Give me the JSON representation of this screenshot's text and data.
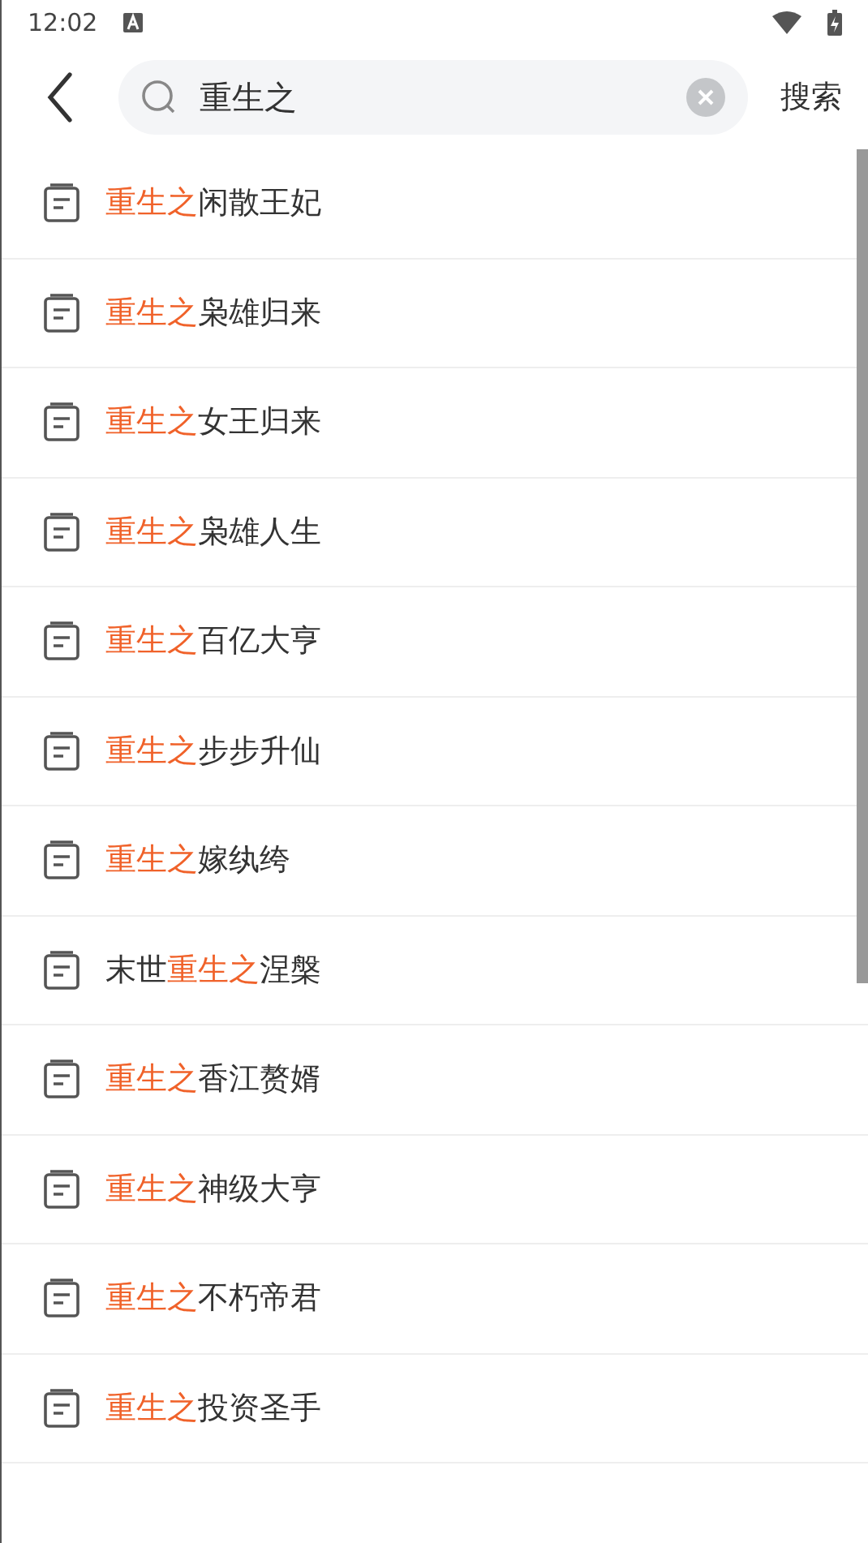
{
  "status_bar": {
    "time": "12:02"
  },
  "search": {
    "value": "重生之",
    "button": "搜索"
  },
  "results": [
    {
      "parts": [
        {
          "text": "重生之",
          "match": true
        },
        {
          "text": "闲散王妃",
          "match": false
        }
      ]
    },
    {
      "parts": [
        {
          "text": "重生之",
          "match": true
        },
        {
          "text": "枭雄归来",
          "match": false
        }
      ]
    },
    {
      "parts": [
        {
          "text": "重生之",
          "match": true
        },
        {
          "text": "女王归来",
          "match": false
        }
      ]
    },
    {
      "parts": [
        {
          "text": "重生之",
          "match": true
        },
        {
          "text": "枭雄人生",
          "match": false
        }
      ]
    },
    {
      "parts": [
        {
          "text": "重生之",
          "match": true
        },
        {
          "text": "百亿大亨",
          "match": false
        }
      ]
    },
    {
      "parts": [
        {
          "text": "重生之",
          "match": true
        },
        {
          "text": "步步升仙",
          "match": false
        }
      ]
    },
    {
      "parts": [
        {
          "text": "重生之",
          "match": true
        },
        {
          "text": "嫁纨绔",
          "match": false
        }
      ]
    },
    {
      "parts": [
        {
          "text": "末世",
          "match": false
        },
        {
          "text": "重生之",
          "match": true
        },
        {
          "text": "涅槃",
          "match": false
        }
      ]
    },
    {
      "parts": [
        {
          "text": "重生之",
          "match": true
        },
        {
          "text": "香江赘婿",
          "match": false
        }
      ]
    },
    {
      "parts": [
        {
          "text": "重生之",
          "match": true
        },
        {
          "text": "神级大亨",
          "match": false
        }
      ]
    },
    {
      "parts": [
        {
          "text": "重生之",
          "match": true
        },
        {
          "text": "不朽帝君",
          "match": false
        }
      ]
    },
    {
      "parts": [
        {
          "text": "重生之",
          "match": true
        },
        {
          "text": "投资圣手",
          "match": false
        }
      ]
    }
  ]
}
